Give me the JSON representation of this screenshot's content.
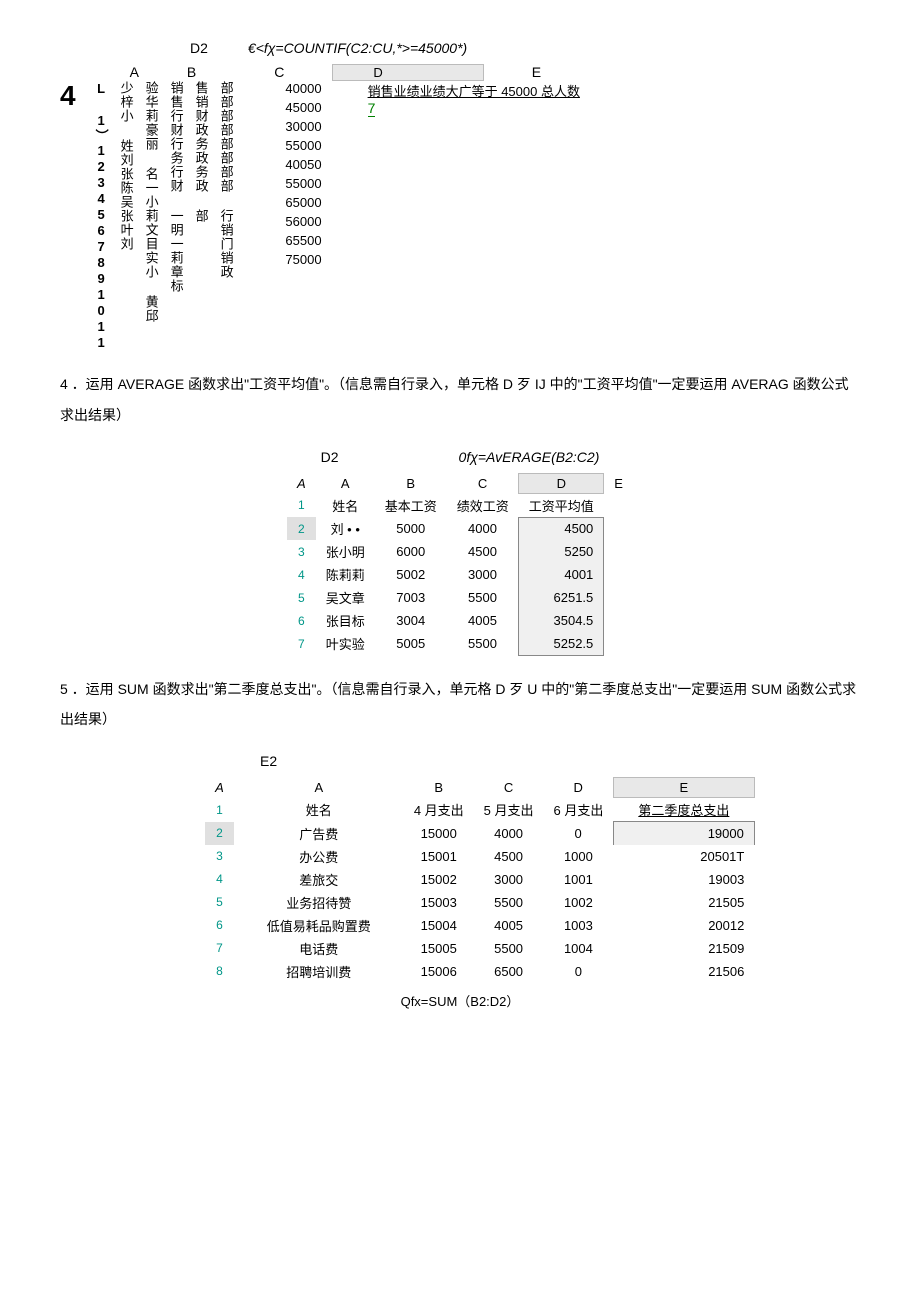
{
  "section1": {
    "formula_cell": "D2",
    "formula_text": "€<fχ=COUNTIF(C2:CU,*>=45000*)",
    "left_number": "4",
    "col_letters": [
      "A",
      "B",
      "C",
      "E"
    ],
    "vertical_rownums": "L 1）1234567891011",
    "vertical_name_header": "少梓小 姓刘张陈吴张叶刘",
    "vertical_name_body": "验华莉豪丽 名一小莉文目实小 黄邱",
    "vertical_dept_header": "销售行财行务行财 一明一莉章标",
    "vertical_dept_body": "售销财政务政务政 部",
    "vertical_dept_tail": "部部部部部部部部 行销门销政",
    "c_values": [
      "40000",
      "45000",
      "30000",
      "55000",
      "40050",
      "55000",
      "65000",
      "56000",
      "65500",
      "75000"
    ],
    "d_header_shaded": "D",
    "d_header_text": "销售业绩业绩大广等于 45000 总人数",
    "d_value": "7"
  },
  "q4_text": "4 ．运用 AVERAGE 函数求出\"工资平均值\"。（信息需自行录入，单元格 D 歹 IJ 中的\"工资平均值\"一定要运用 AVERAG 函数公式求出结果）",
  "section2": {
    "formula_cell": "D2",
    "formula_text": "0fχ=AvERAGE(B2:C2)",
    "corner": "A",
    "col_letters": [
      "A",
      "B",
      "C",
      "D",
      "E"
    ],
    "headers": [
      "姓名",
      "基本工资",
      "绩效工资",
      "工资平均值"
    ],
    "rows": [
      {
        "n": "1"
      },
      {
        "n": "2",
        "name": "刘 • •",
        "b": "5000",
        "c": "4000",
        "d": "4500"
      },
      {
        "n": "3",
        "name": "张小明",
        "b": "6000",
        "c": "4500",
        "d": "5250"
      },
      {
        "n": "4",
        "name": "陈莉莉",
        "b": "5002",
        "c": "3000",
        "d": "4001"
      },
      {
        "n": "5",
        "name": "吴文章",
        "b": "7003",
        "c": "5500",
        "d": "6251.5"
      },
      {
        "n": "6",
        "name": "张目标",
        "b": "3004",
        "c": "4005",
        "d": "3504.5"
      },
      {
        "n": "7",
        "name": "叶实验",
        "b": "5005",
        "c": "5500",
        "d": "5252.5"
      }
    ]
  },
  "q5_text": "5 ．运用 SUM 函数求出\"第二季度总支出\"。（信息需自行录入，单元格 D 歹 U 中的\"第二季度总支出\"一定要运用 SUM 函数公式求出结果）",
  "section3": {
    "formula_cell": "E2",
    "corner": "A",
    "col_letters": [
      "A",
      "B",
      "C",
      "D",
      "E"
    ],
    "headers": [
      "姓名",
      "4 月支出",
      "5 月支出",
      "6 月支出",
      "第二季度总支出"
    ],
    "rows": [
      {
        "n": "1"
      },
      {
        "n": "2",
        "a": "广告费",
        "b": "15000",
        "c": "4000",
        "d": "0",
        "e": "19000"
      },
      {
        "n": "3",
        "a": "办公费",
        "b": "15001",
        "c": "4500",
        "d": "1000",
        "e": "20501T"
      },
      {
        "n": "4",
        "a": "差旅交",
        "b": "15002",
        "c": "3000",
        "d": "1001",
        "e": "19003"
      },
      {
        "n": "5",
        "a": "业务招待赞",
        "b": "15003",
        "c": "5500",
        "d": "1002",
        "e": "21505"
      },
      {
        "n": "6",
        "a": "低值易耗品购置费",
        "b": "15004",
        "c": "4005",
        "d": "1003",
        "e": "20012"
      },
      {
        "n": "7",
        "a": "电话费",
        "b": "15005",
        "c": "5500",
        "d": "1004",
        "e": "21509"
      },
      {
        "n": "8",
        "a": "招聘培训费",
        "b": "15006",
        "c": "6500",
        "d": "0",
        "e": "21506"
      }
    ],
    "bottom_formula": "Qfx=SUM（B2:D2）"
  }
}
